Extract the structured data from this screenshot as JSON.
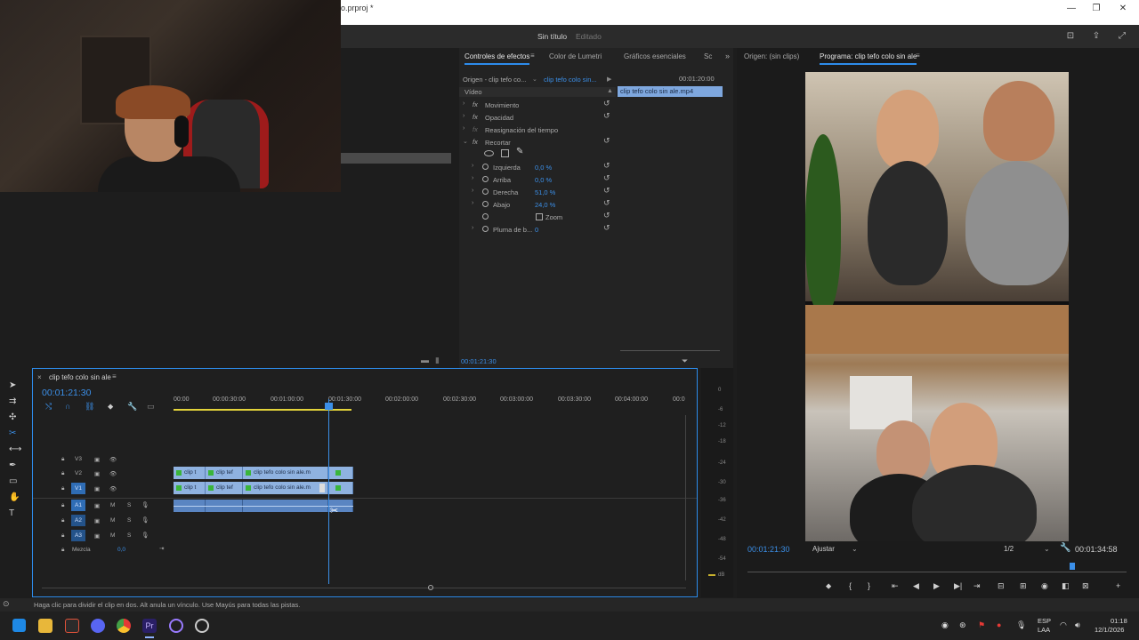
{
  "window": {
    "title_partial": "o.prproj *",
    "project": "Sin título",
    "status": "Editado"
  },
  "effects_panel": {
    "tabs": [
      "Controles de efectos",
      "Color de Lumetri",
      "Gráficos esenciales",
      "Sc"
    ],
    "source": "Origen - clip tefo co...",
    "clip": "clip tefo colo sin...",
    "time_ruler": "00:01:20:00",
    "clip_bar": "clip tefo colo sin ale.mp4",
    "section": "Vídeo",
    "effects": {
      "movimiento": "Movimiento",
      "opacidad": "Opacidad",
      "reasignacion": "Reasignación del tiempo",
      "recortar": "Recortar"
    },
    "params": [
      {
        "label": "Izquierda",
        "value": "0,0 %"
      },
      {
        "label": "Arriba",
        "value": "0,0 %"
      },
      {
        "label": "Derecha",
        "value": "51,0 %"
      },
      {
        "label": "Abajo",
        "value": "24,0 %"
      }
    ],
    "zoom_label": "Zoom",
    "feather": {
      "label": "Pluma de b...",
      "value": "0"
    },
    "footer_time": "00:01:21:30"
  },
  "program_monitor": {
    "tab_source": "Origen: (sin clips)",
    "tab_program": "Programa: clip tefo colo sin ale",
    "current_time": "00:01:21:30",
    "fit": "Ajustar",
    "resolution": "1/2",
    "duration": "00:01:34:58"
  },
  "timeline": {
    "sequence": "clip tefo colo sin ale",
    "timecode": "00:01:21:30",
    "ruler": [
      "00:00",
      "00:00:30:00",
      "00:01:00:00",
      "00:01:30:00",
      "00:02:00:00",
      "00:02:30:00",
      "00:03:00:00",
      "00:03:30:00",
      "00:04:00:00",
      "00:0"
    ],
    "video_tracks": [
      "V3",
      "V2",
      "V1"
    ],
    "audio_tracks": [
      "A1",
      "A2",
      "A3"
    ],
    "mix_label": "Mezcla",
    "mix_value": "0,0",
    "m_label": "M",
    "s_label": "S",
    "clips_v2": [
      "clip t",
      "clip tef",
      "clip tefo colo sin ale.m",
      ""
    ],
    "clips_v1": [
      "clip t",
      "clip tef",
      "clip tefo colo sin ale.m",
      ""
    ]
  },
  "meters": [
    "0",
    "-6",
    "-12",
    "-18",
    "-24",
    "-30",
    "-36",
    "-42",
    "-48",
    "-54",
    "dB"
  ],
  "status_message": "Haga clic para dividir el clip en dos. Alt anula un vínculo. Use Mayús para todas las pistas.",
  "taskbar": {
    "lang": "ESP",
    "lang2": "LAA",
    "time": "01:18",
    "date": "12/1/2026"
  }
}
